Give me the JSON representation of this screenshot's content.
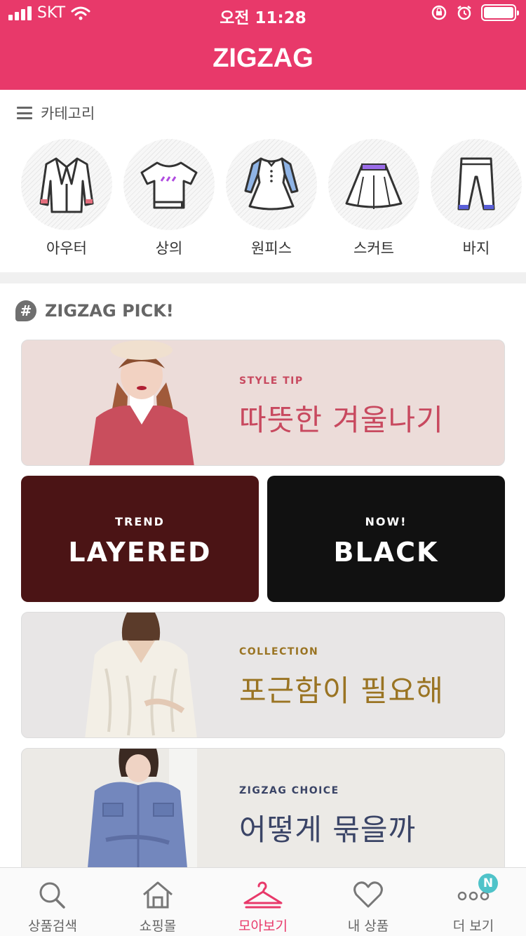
{
  "status_bar": {
    "carrier": "SKT",
    "time": "오전 11:28"
  },
  "header": {
    "brand": "ZIGZAG"
  },
  "category": {
    "title": "카테고리",
    "items": [
      {
        "label": "아우터",
        "icon": "jacket-icon"
      },
      {
        "label": "상의",
        "icon": "tshirt-icon"
      },
      {
        "label": "원피스",
        "icon": "dress-icon"
      },
      {
        "label": "스커트",
        "icon": "skirt-icon"
      },
      {
        "label": "바지",
        "icon": "pants-icon"
      }
    ]
  },
  "pick": {
    "title": "ZIGZAG PICK!",
    "banners": [
      {
        "kicker": "STYLE TIP",
        "title": "따뜻한 겨울나기",
        "color": "#c8495f"
      },
      {
        "kicker": "TREND",
        "title": "LAYERED"
      },
      {
        "kicker": "NOW!",
        "title": "BLACK"
      },
      {
        "kicker": "COLLECTION",
        "title": "포근함이 필요해",
        "color": "#9a7423"
      },
      {
        "kicker": "ZIGZAG CHOICE",
        "title": "어떻게 묶을까",
        "color": "#3a4466"
      }
    ]
  },
  "tabbar": {
    "tabs": [
      {
        "label": "상품검색",
        "icon": "search-icon"
      },
      {
        "label": "쇼핑몰",
        "icon": "home-icon"
      },
      {
        "label": "모아보기",
        "icon": "hanger-icon",
        "active": true
      },
      {
        "label": "내 상품",
        "icon": "heart-icon"
      },
      {
        "label": "더 보기",
        "icon": "more-icon",
        "badge": "N"
      }
    ]
  },
  "colors": {
    "brand": "#e8396a",
    "badge": "#4fc3c9"
  }
}
